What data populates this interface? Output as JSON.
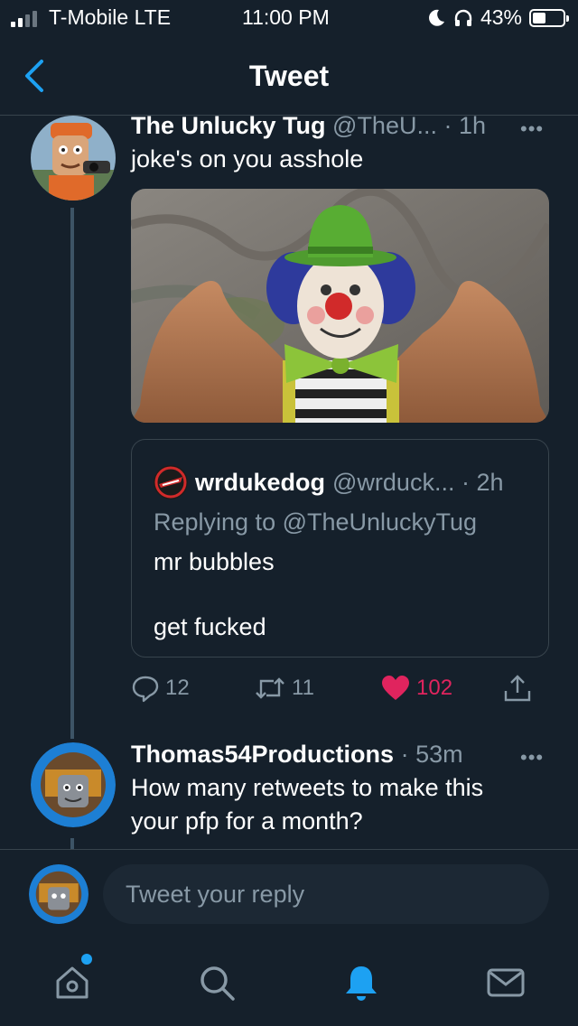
{
  "status_bar": {
    "carrier": "T-Mobile LTE",
    "time": "11:00 PM",
    "battery": "43%",
    "battery_level": 0.43
  },
  "nav": {
    "title": "Tweet"
  },
  "main_tweet": {
    "name": "The Unlucky Tug",
    "handle": "@TheU...",
    "time": "· 1h",
    "more": "•••",
    "text": "joke's on you asshole",
    "quote": {
      "name": "wrdukedog",
      "handle": "@wrduck... · 2h",
      "replying_to": "Replying to @TheUnluckyTug",
      "text_line1": "mr bubbles",
      "text_line2": "get fucked"
    },
    "actions": {
      "replies": "12",
      "retweets": "11",
      "likes": "102"
    }
  },
  "reply_tweet": {
    "name": "Thomas54Productions",
    "time": "· 53m",
    "more": "•••",
    "text_line1": "How many retweets to make this",
    "text_line2": "your pfp for a month?"
  },
  "reply_bar": {
    "placeholder": "Tweet your reply"
  },
  "colors": {
    "background": "#15202b",
    "accent": "#1da1f2",
    "like": "#e0245e",
    "secondary_text": "#8899a6"
  }
}
